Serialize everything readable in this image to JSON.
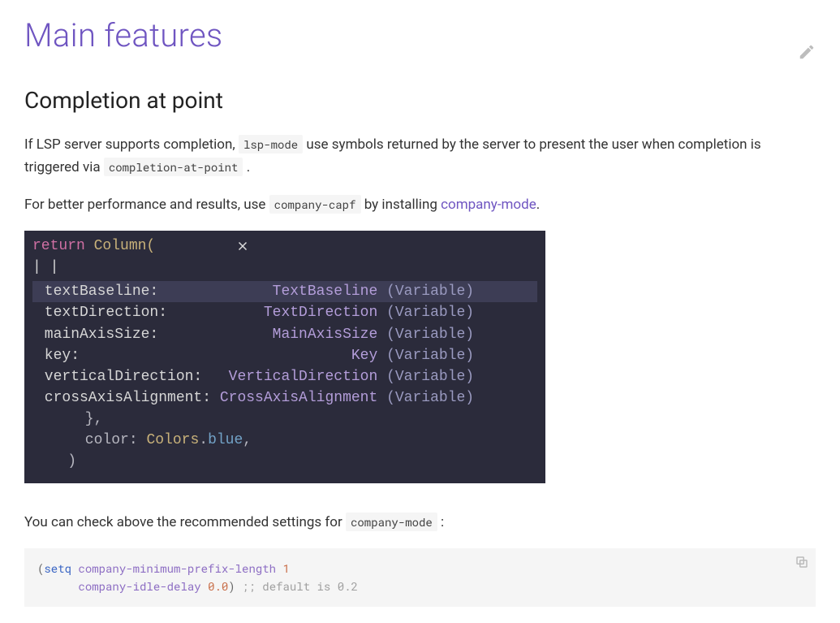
{
  "header": {
    "title": "Main features"
  },
  "section": {
    "title": "Completion at point",
    "para1_a": "If LSP server supports completion, ",
    "para1_code1": "lsp-mode",
    "para1_b": " use symbols returned by the server to present the user when completion is triggered via ",
    "para1_code2": "completion-at-point",
    "para1_c": " .",
    "para2_a": "For better performance and results, use ",
    "para2_code": "company-capf",
    "para2_b": " by installing ",
    "para2_link": "company-mode",
    "para2_c": "."
  },
  "editor": {
    "line1_kw": "return",
    "line1_rest": " Column(",
    "cursor": "| |",
    "popup": [
      {
        "left": "textBaseline:",
        "type": "TextBaseline",
        "kind": " (Variable)",
        "sel": true
      },
      {
        "left": "textDirection:",
        "type": "TextDirection",
        "kind": " (Variable)",
        "sel": false
      },
      {
        "left": "mainAxisSize:",
        "type": "MainAxisSize",
        "kind": " (Variable)",
        "sel": false
      },
      {
        "left": "key:",
        "type": "Key",
        "kind": " (Variable)",
        "sel": false
      },
      {
        "left": "verticalDirection:",
        "type": "VerticalDirection",
        "kind": " (Variable)",
        "sel": false
      },
      {
        "left": "crossAxisAlignment:",
        "type": "CrossAxisAlignment",
        "kind": " (Variable)",
        "sel": false
      }
    ],
    "tail_brace": "      },",
    "tail_color_label": "      color: ",
    "tail_color_class": "Colors",
    "tail_color_dot": ".",
    "tail_color_member": "blue",
    "tail_color_comma": ",",
    "tail_paren": "    )"
  },
  "after": {
    "text_a": "You can check above the recommended settings for ",
    "code": "company-mode",
    "text_b": " :"
  },
  "codeblock": {
    "open": "(",
    "setq": "setq",
    "sym1": "company-minimum-prefix-length",
    "num1": "1",
    "indent": "      ",
    "sym2": "company-idle-delay",
    "num2": "0.0",
    "close": ")",
    "comment": " ;; default is 0.2"
  }
}
